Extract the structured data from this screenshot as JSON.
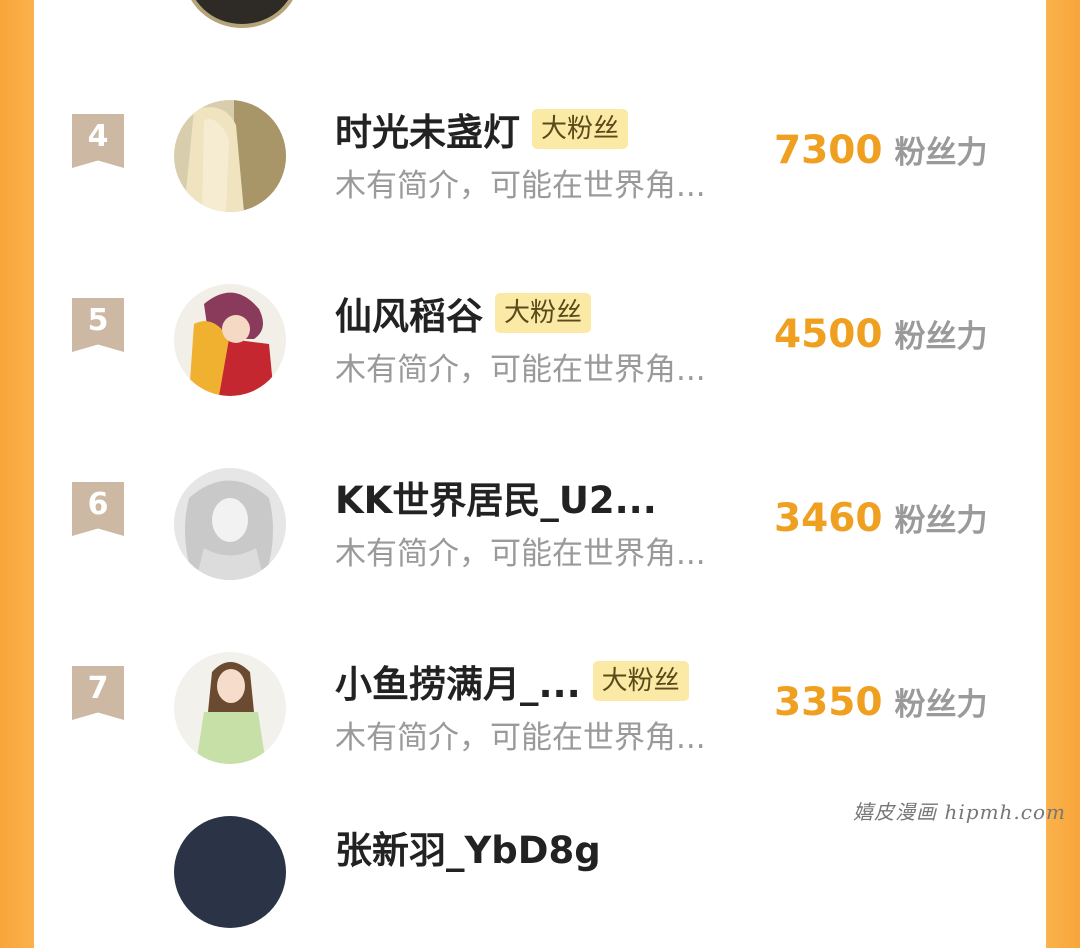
{
  "rows": [
    {
      "rank": "4",
      "name": "时光未盏灯",
      "badge": "大粉丝",
      "desc": "木有简介，可能在世界角...",
      "score": "7300",
      "unit": "粉丝力"
    },
    {
      "rank": "5",
      "name": "仙风稻谷",
      "badge": "大粉丝",
      "desc": "木有简介，可能在世界角...",
      "score": "4500",
      "unit": "粉丝力"
    },
    {
      "rank": "6",
      "name": "KK世界居民_U2...",
      "badge": "",
      "desc": "木有简介，可能在世界角...",
      "score": "3460",
      "unit": "粉丝力"
    },
    {
      "rank": "7",
      "name": "小鱼捞满月_...",
      "badge": "大粉丝",
      "desc": "木有简介，可能在世界角...",
      "score": "3350",
      "unit": "粉丝力"
    },
    {
      "name": "张新羽_YbD8g"
    }
  ],
  "watermark": "嬉皮漫画 hipmh.com",
  "colors": {
    "accent": "#f0a020",
    "rank_badge": "#cdb8a3",
    "fan_badge": "#fbeaa6",
    "side": "#f8a53a"
  }
}
